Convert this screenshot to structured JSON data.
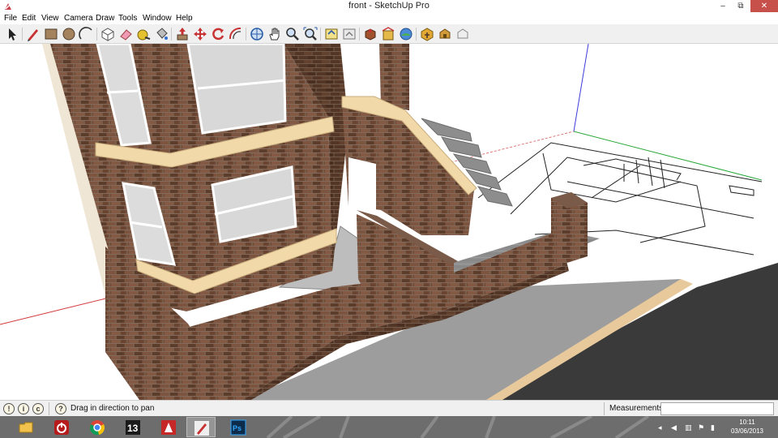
{
  "window": {
    "title": "front - SketchUp Pro",
    "minimize_glyph": "‒",
    "maximize_glyph": "⧉",
    "close_glyph": "✕"
  },
  "menu": [
    "File",
    "Edit",
    "View",
    "Camera",
    "Draw",
    "Tools",
    "Window",
    "Help"
  ],
  "toolbar": {
    "tools": [
      "select-icon",
      "pencil-line-icon",
      "rectangle-icon",
      "circle-icon",
      "arc-icon",
      "make-component-icon",
      "eraser-icon",
      "tape-measure-icon",
      "paint-bucket-icon",
      "push-pull-icon",
      "move-icon",
      "rotate-icon",
      "offset-icon",
      "orbit-icon",
      "pan-hand-icon",
      "zoom-icon",
      "zoom-extents-icon",
      "get-models-icon",
      "share-model-icon",
      "component-browser-icon",
      "building-maker-icon",
      "photo-textures-icon",
      "extension-warehouse-icon",
      "preview-model-icon",
      "share-component-icon"
    ]
  },
  "statusbar": {
    "hint": "Drag in direction to pan",
    "measurements_label": "Measurements",
    "measurements_value": ""
  },
  "taskbar": {
    "apps": [
      "file-explorer-icon",
      "power-icon",
      "chrome-icon",
      "app-13-icon",
      "autocad-icon",
      "sketchup-icon",
      "photoshop-icon"
    ],
    "app13_text": "13",
    "photoshop_text": "Ps",
    "tray": {
      "time": "10:11",
      "date": "03/06/2013"
    }
  },
  "colors": {
    "brick": "#6e4a36",
    "brick_mortar": "#8a7565",
    "cream_trim": "#f1d9aa",
    "paving": "#8f8f8f",
    "road": "#3a3a3a",
    "window_glass": "#dcdcdc",
    "axis_red": "#d23a3a",
    "axis_green": "#2ca83a",
    "axis_blue": "#3d3dd8",
    "taskbar": "#6d6d6d"
  }
}
